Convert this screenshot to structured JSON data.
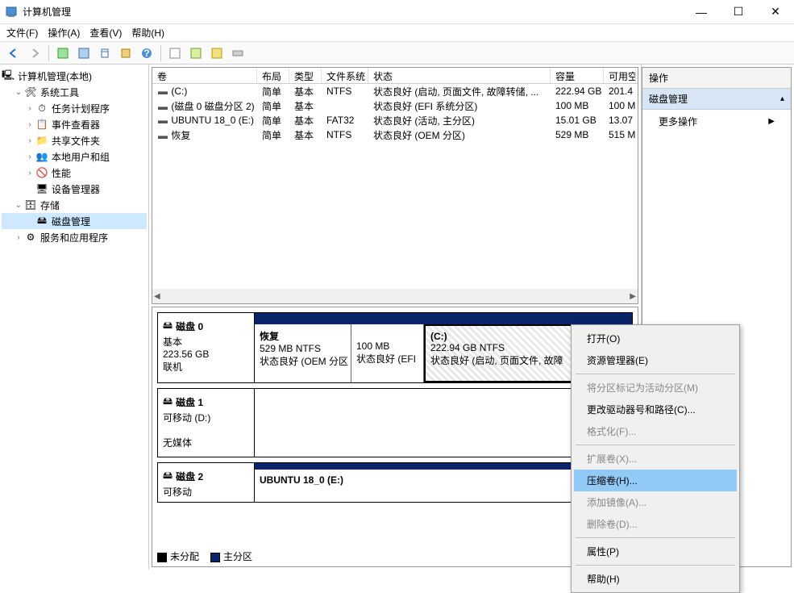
{
  "window": {
    "title": "计算机管理"
  },
  "menu": {
    "file": "文件(F)",
    "action": "操作(A)",
    "view": "查看(V)",
    "help": "帮助(H)"
  },
  "tree": {
    "root": "计算机管理(本地)",
    "system_tools": "系统工具",
    "task_scheduler": "任务计划程序",
    "event_viewer": "事件查看器",
    "shared_folders": "共享文件夹",
    "local_users": "本地用户和组",
    "performance": "性能",
    "device_manager": "设备管理器",
    "storage": "存储",
    "disk_management": "磁盘管理",
    "services": "服务和应用程序"
  },
  "table": {
    "columns": {
      "volume": "卷",
      "layout": "布局",
      "type": "类型",
      "fs": "文件系统",
      "status": "状态",
      "capacity": "容量",
      "free": "可用空间"
    },
    "rows": [
      {
        "icon": "▬",
        "vol": "(C:)",
        "layout": "简单",
        "type": "基本",
        "fs": "NTFS",
        "status": "状态良好 (启动, 页面文件, 故障转储, ...",
        "capacity": "222.94 GB",
        "free": "201.4"
      },
      {
        "icon": "▬",
        "vol": "(磁盘 0 磁盘分区 2)",
        "layout": "简单",
        "type": "基本",
        "fs": "",
        "status": "状态良好 (EFI 系统分区)",
        "capacity": "100 MB",
        "free": "100 M"
      },
      {
        "icon": "▬",
        "vol": "UBUNTU 18_0 (E:)",
        "layout": "简单",
        "type": "基本",
        "fs": "FAT32",
        "status": "状态良好 (活动, 主分区)",
        "capacity": "15.01 GB",
        "free": "13.07"
      },
      {
        "icon": "▬",
        "vol": "恢复",
        "layout": "简单",
        "type": "基本",
        "fs": "NTFS",
        "status": "状态良好 (OEM 分区)",
        "capacity": "529 MB",
        "free": "515 M"
      }
    ]
  },
  "disks": {
    "disk0": {
      "name": "磁盘 0",
      "type": "基本",
      "size": "223.56 GB",
      "state": "联机"
    },
    "disk1": {
      "name": "磁盘 1",
      "type": "可移动 (D:)",
      "state": "无媒体"
    },
    "disk2": {
      "name": "磁盘 2",
      "type": "可移动"
    },
    "part_recovery_line1": "恢复",
    "part_recovery_line2": "529 MB NTFS",
    "part_recovery_line3": "状态良好 (OEM 分区",
    "part_efi_line1": "100 MB",
    "part_efi_line2": "状态良好 (EFI",
    "part_c_line1": "(C:)",
    "part_c_line2": "222.94 GB NTFS",
    "part_c_line3": "状态良好 (启动, 页面文件, 故障",
    "part_ubuntu": "UBUNTU 18_0  (E:)"
  },
  "legend": {
    "unallocated": "未分配",
    "primary": "主分区"
  },
  "actions": {
    "header": "操作",
    "sub": "磁盘管理",
    "more": "更多操作"
  },
  "context": {
    "open": "打开(O)",
    "explorer": "资源管理器(E)",
    "active": "将分区标记为活动分区(M)",
    "changeletter": "更改驱动器号和路径(C)...",
    "format": "格式化(F)...",
    "extend": "扩展卷(X)...",
    "shrink": "压缩卷(H)...",
    "mirror": "添加镜像(A)...",
    "delete": "删除卷(D)...",
    "properties": "属性(P)",
    "help": "帮助(H)"
  }
}
